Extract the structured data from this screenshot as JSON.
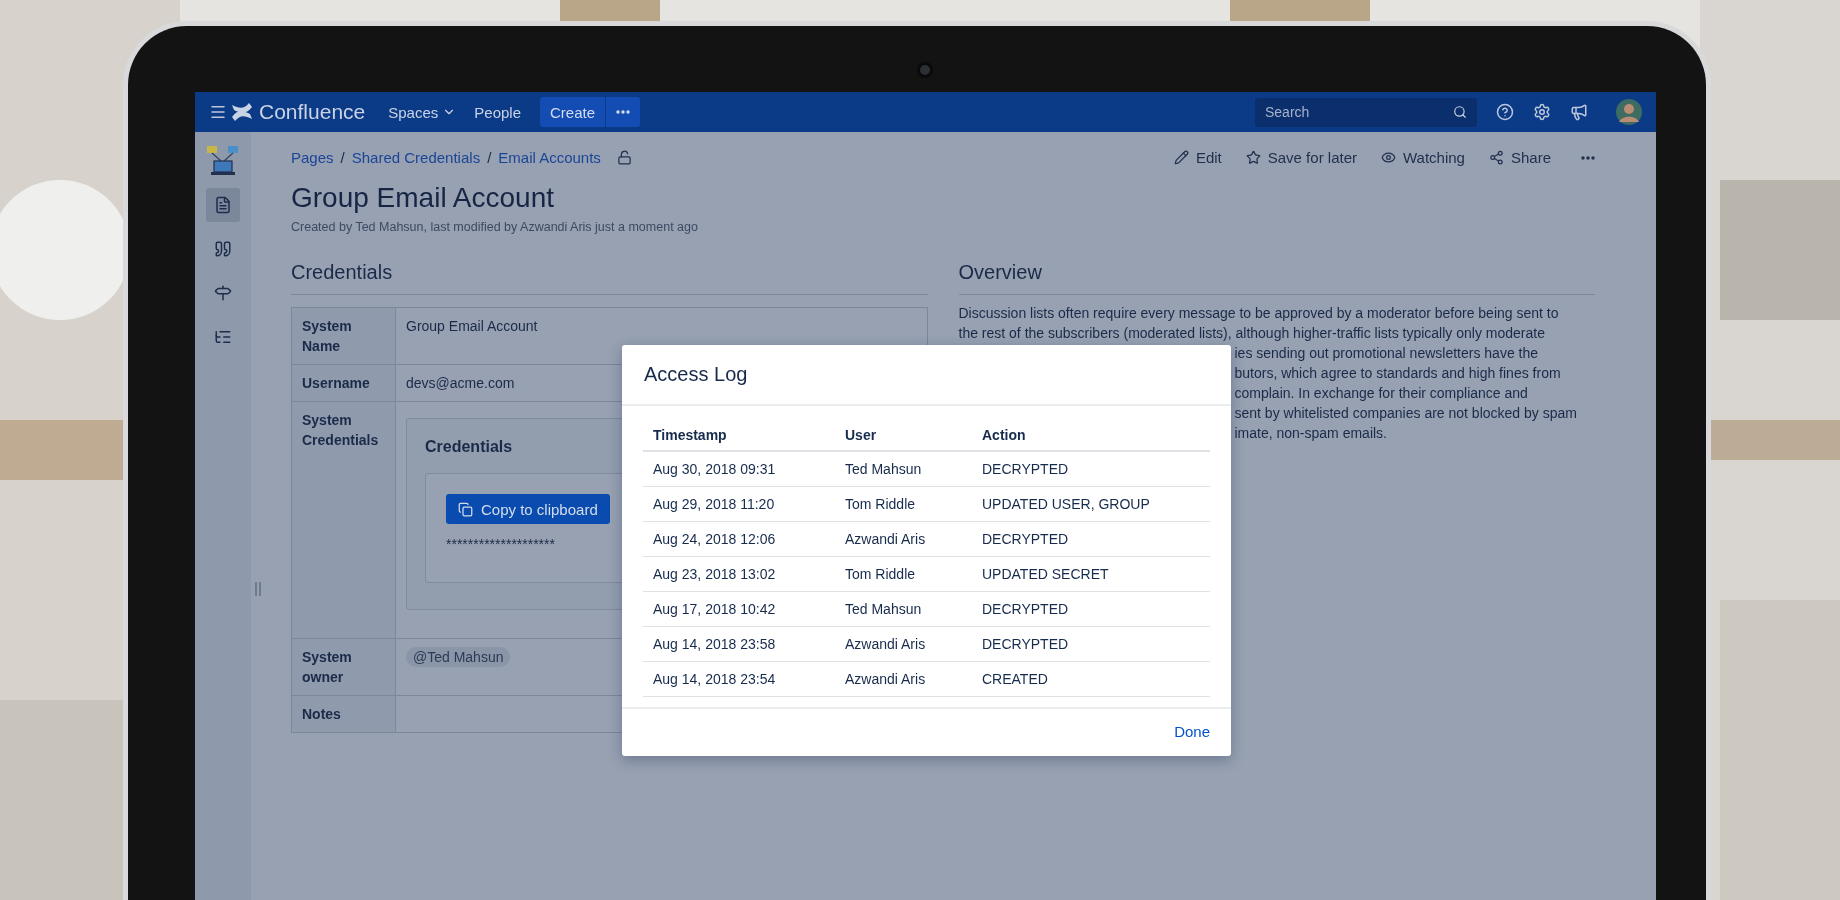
{
  "nav": {
    "brand": "Confluence",
    "items": [
      {
        "label": "Spaces",
        "dropdown": true
      },
      {
        "label": "People",
        "dropdown": false
      }
    ],
    "create": "Create",
    "search": {
      "placeholder": "Search"
    }
  },
  "sidebar": {
    "items": [
      {
        "selected": true
      },
      {
        "selected": false
      },
      {
        "selected": false
      },
      {
        "selected": false
      }
    ]
  },
  "breadcrumbs": {
    "separator": "/",
    "items": [
      "Pages",
      "Shared Credentials",
      "Email Accounts"
    ]
  },
  "page_actions": [
    "Edit",
    "Save for later",
    "Watching",
    "Share"
  ],
  "title": "Group Email Account",
  "byline": "Created by Ted Mahsun, last modified by Azwandi Aris just a moment ago",
  "credentials": {
    "heading": "Credentials",
    "rows": [
      {
        "kind": "text",
        "label": "System Name",
        "value": "Group Email Account"
      },
      {
        "kind": "text",
        "label": "Username",
        "value": "devs@acme.com"
      },
      {
        "kind": "secret",
        "label": "System Credentials",
        "panel": {
          "heading": "Credentials",
          "button": "Copy to clipboard",
          "masked": "********************"
        }
      },
      {
        "kind": "mention",
        "label": "System owner",
        "value": "@Ted Mahsun"
      },
      {
        "kind": "text",
        "label": "Notes"
      }
    ]
  },
  "overview": {
    "heading": "Overview",
    "lines": [
      {
        "text": "Discussion lists often require every message to be approved by a moderator before being sent to",
        "covered": false
      },
      {
        "text": "the rest of the subscribers (moderated lists), although higher-traffic lists typically only moderate",
        "covered": false
      },
      {
        "text": "ies sending out promotional newsletters have the",
        "covered": true
      },
      {
        "text": "butors, which agree to standards and high fines from",
        "covered": true
      },
      {
        "text": "complain. In exchange for their compliance and",
        "covered": true
      },
      {
        "text": "sent by whitelisted companies are not blocked by spam",
        "covered": true
      },
      {
        "text": "imate, non-spam emails.",
        "covered": true
      }
    ]
  },
  "dialog": {
    "title": "Access Log",
    "columns": [
      "Timestamp",
      "User",
      "Action"
    ],
    "rows": [
      [
        "Aug 30, 2018 09:31",
        "Ted Mahsun",
        "DECRYPTED"
      ],
      [
        "Aug 29, 2018 11:20",
        "Tom Riddle",
        "UPDATED USER, GROUP"
      ],
      [
        "Aug 24, 2018 12:06",
        "Azwandi Aris",
        "DECRYPTED"
      ],
      [
        "Aug 23, 2018 13:02",
        "Tom Riddle",
        "UPDATED SECRET"
      ],
      [
        "Aug 17, 2018 10:42",
        "Ted Mahsun",
        "DECRYPTED"
      ],
      [
        "Aug 14, 2018 23:58",
        "Azwandi Aris",
        "DECRYPTED"
      ],
      [
        "Aug 14, 2018 23:54",
        "Azwandi Aris",
        "CREATED"
      ]
    ],
    "done": "Done"
  }
}
